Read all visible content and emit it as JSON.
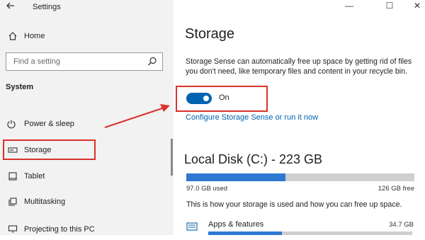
{
  "app": {
    "title": "Settings"
  },
  "nav": {
    "back_icon": "back-arrow-icon",
    "home": {
      "label": "Home",
      "icon": "home-icon"
    },
    "search": {
      "placeholder": "Find a setting",
      "icon": "search-icon"
    },
    "section_title": "System",
    "items": [
      {
        "label": "Power & sleep",
        "icon": "power-icon"
      },
      {
        "label": "Storage",
        "icon": "storage-icon",
        "selected": true
      },
      {
        "label": "Tablet",
        "icon": "tablet-icon"
      },
      {
        "label": "Multitasking",
        "icon": "multitasking-icon"
      },
      {
        "label": "Projecting to this PC",
        "icon": "projecting-icon"
      }
    ]
  },
  "window_controls": {
    "minimize": "—",
    "maximize": "☐",
    "close": "✕"
  },
  "main": {
    "title": "Storage",
    "description": "Storage Sense can automatically free up space by getting rid of files you don't need, like temporary files and content in your recycle bin.",
    "toggle": {
      "state_label": "On",
      "on": true
    },
    "configure_link": "Configure Storage Sense or run it now",
    "disk": {
      "title": "Local Disk (C:) - 223 GB",
      "used_label": "97.0 GB used",
      "free_label": "126 GB free",
      "used_fraction": 0.435
    },
    "info_text": "This is how your storage is used and how you can free up space.",
    "categories": [
      {
        "label": "Apps & features",
        "size": "34.7 GB",
        "fraction": 0.36,
        "icon": "apps-icon"
      }
    ]
  },
  "colors": {
    "accent": "#0063b1",
    "highlight": "#d9322b",
    "bar_fill": "#2f78d2",
    "bar_track": "#cfcfcf"
  }
}
